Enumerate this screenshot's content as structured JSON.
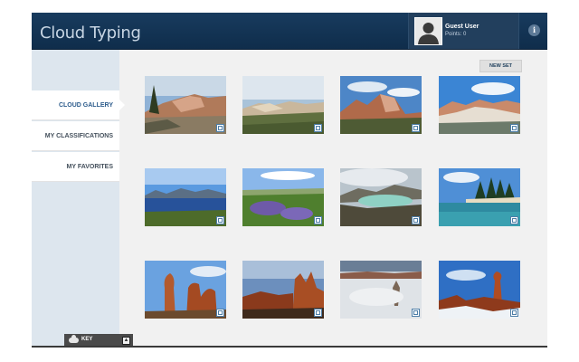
{
  "header": {
    "app_title": "Cloud Typing",
    "user": {
      "name": "Guest User",
      "points": "Points: 0",
      "avatar_icon": "user-silhouette-icon"
    },
    "info_icon": "info-icon",
    "info_glyph": "i"
  },
  "sidebar": {
    "items": [
      {
        "label": "CLOUD GALLERY",
        "active": true
      },
      {
        "label": "MY CLASSIFICATIONS",
        "active": false
      },
      {
        "label": "MY FAVORITES",
        "active": false
      }
    ],
    "key": {
      "label": "KEY",
      "icon": "cloud-icon",
      "button": "up-arrow-icon",
      "button_glyph": "▲"
    }
  },
  "main": {
    "new_set_label": "NEW SET",
    "gallery_rows": 3,
    "gallery_cols": 4,
    "gallery_count": 12
  },
  "colors": {
    "header_bg": "#163a5c",
    "accent": "#2d5c8c",
    "sidebar_bg": "#dde6ee",
    "content_bg": "#f1f1f1"
  }
}
